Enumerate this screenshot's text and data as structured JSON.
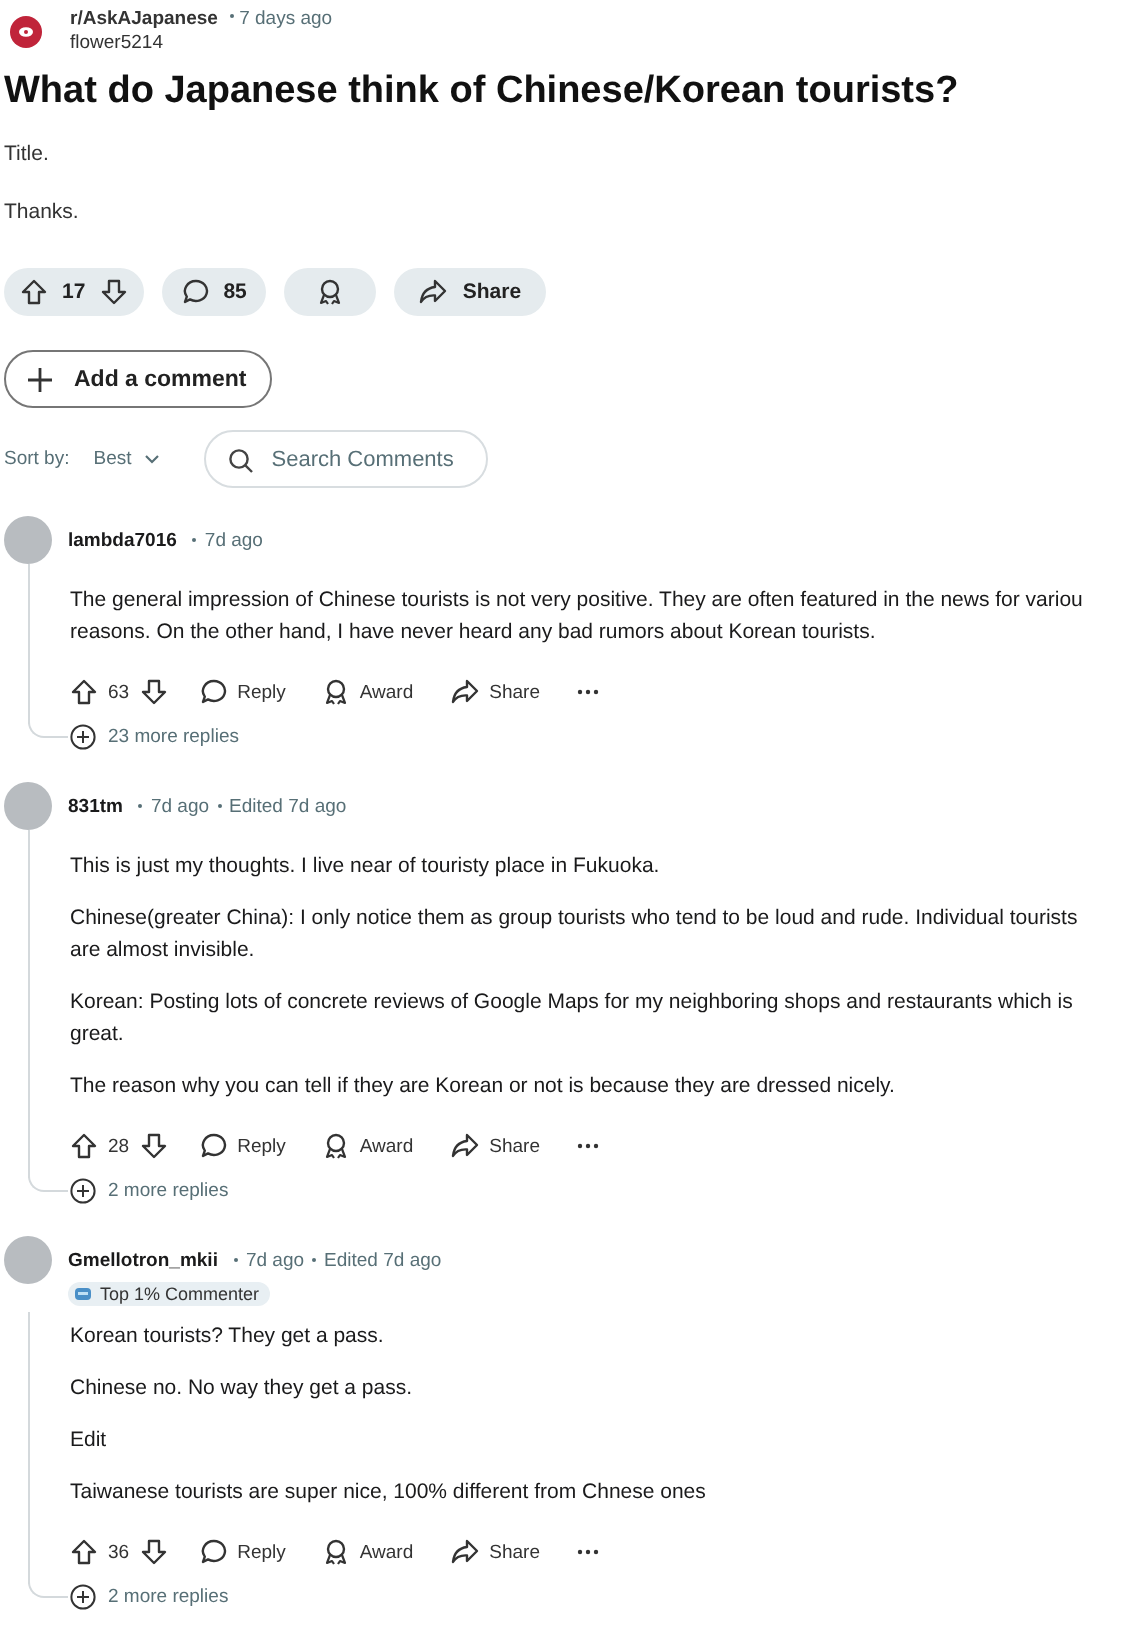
{
  "post": {
    "subreddit": "r/AskAJapanese",
    "time": "7 days ago",
    "author": "flower5214",
    "title": "What do Japanese think of Chinese/Korean tourists?",
    "body": [
      "Title.",
      "Thanks."
    ],
    "votes": "17",
    "comments": "85",
    "share": "Share"
  },
  "add_comment": "Add a comment",
  "sort": {
    "label": "Sort by:",
    "value": "Best"
  },
  "search": {
    "placeholder": "Search Comments"
  },
  "comments": [
    {
      "author": "lambda7016",
      "time": "7d ago",
      "paragraphs": [
        "The general impression of Chinese tourists is not very positive. They are often featured in the news for variou\nreasons. On the other hand, I have never heard any bad rumors about Korean tourists."
      ],
      "votes": "63",
      "reply": "Reply",
      "award": "Award",
      "share": "Share",
      "more_replies": "23 more replies"
    },
    {
      "author": "831tm",
      "time": "7d ago",
      "edited": "Edited 7d ago",
      "paragraphs": [
        "This is just my thoughts. I live near of touristy place in Fukuoka.",
        "Chinese(greater China): I only notice them as group tourists who tend to be loud and rude. Individual tourists\nare almost invisible.",
        "Korean: Posting lots of concrete reviews of Google Maps for my neighboring shops and restaurants which is\ngreat.",
        "The reason why you can tell if they are Korean or not is because they are dressed nicely."
      ],
      "votes": "28",
      "reply": "Reply",
      "award": "Award",
      "share": "Share",
      "more_replies": "2 more replies"
    },
    {
      "author": "Gmellotron_mkii",
      "time": "7d ago",
      "edited": "Edited 7d ago",
      "flair": "Top 1% Commenter",
      "paragraphs": [
        "Korean tourists? They get a pass.",
        "Chinese no. No way they get a pass.",
        "Edit",
        "Taiwanese tourists are super nice, 100% different from Chnese ones"
      ],
      "votes": "36",
      "reply": "Reply",
      "award": "Award",
      "share": "Share",
      "more_replies": "2 more replies"
    }
  ]
}
